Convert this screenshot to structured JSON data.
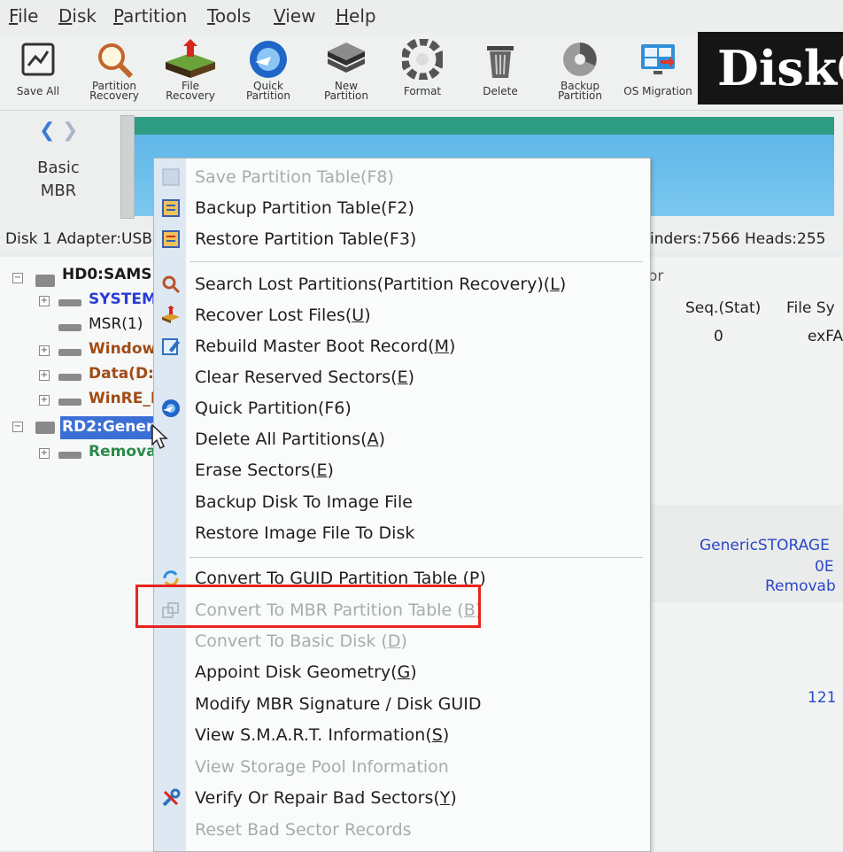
{
  "menubar": [
    {
      "pre": "",
      "u": "F",
      "post": "ile"
    },
    {
      "pre": "",
      "u": "D",
      "post": "isk"
    },
    {
      "pre": "",
      "u": "P",
      "post": "artition"
    },
    {
      "pre": "",
      "u": "T",
      "post": "ools"
    },
    {
      "pre": "",
      "u": "V",
      "post": "iew"
    },
    {
      "pre": "",
      "u": "H",
      "post": "elp"
    }
  ],
  "toolbar": [
    {
      "line1": "Save All",
      "line2": "",
      "icon": "save-all-icon"
    },
    {
      "line1": "Partition",
      "line2": "Recovery",
      "icon": "magnifier-icon"
    },
    {
      "line1": "File",
      "line2": "Recovery",
      "icon": "file-recovery-icon"
    },
    {
      "line1": "Quick",
      "line2": "Partition",
      "icon": "quick-partition-icon"
    },
    {
      "line1": "New",
      "line2": "Partition",
      "icon": "new-partition-icon"
    },
    {
      "line1": "Format",
      "line2": "",
      "icon": "format-icon"
    },
    {
      "line1": "Delete",
      "line2": "",
      "icon": "trash-icon"
    },
    {
      "line1": "Backup",
      "line2": "Partition",
      "icon": "backup-partition-icon"
    },
    {
      "line1": "OS Migration",
      "line2": "",
      "icon": "os-migration-icon"
    }
  ],
  "logo": "DiskG",
  "disk_mode": {
    "line1": "Basic",
    "line2": "MBR"
  },
  "disk_info": {
    "left": "Disk 1 Adapter:USB",
    "right": "inders:7566  Heads:255"
  },
  "tree": [
    {
      "label": "HD0:SAMS",
      "color": "#1a1a1a"
    },
    {
      "label": "SYSTEM",
      "color": "#2a3bd8"
    },
    {
      "label": "MSR(1)",
      "color": "#1a1a1a"
    },
    {
      "label": "Window",
      "color": "#a04b15"
    },
    {
      "label": "Data(D:",
      "color": "#a04b15"
    },
    {
      "label": "WinRE_I",
      "color": "#a04b15"
    },
    {
      "label": "RD2:Gener",
      "color": "#ffffff"
    },
    {
      "label": "Remova",
      "color": "#2a8a4a"
    }
  ],
  "right_pane": {
    "col_partial": "or",
    "seq_header": "Seq.(Stat)",
    "fs_header": "File Sy",
    "seq_value": "0",
    "fs_value": "exFA",
    "model": "GenericSTORAGE",
    "model_id": "0E",
    "type": "Removab",
    "number": "121"
  },
  "context_menu": [
    {
      "text": "Save Partition Table(F8)",
      "disabled": true,
      "icon": "save-table-icon"
    },
    {
      "text": "Backup Partition Table(F2)",
      "disabled": false,
      "icon": "backup-table-icon"
    },
    {
      "text": "Restore Partition Table(F3)",
      "disabled": false,
      "icon": "restore-table-icon"
    },
    {
      "text": "Search Lost Partitions(Partition Recovery)(",
      "u": "L",
      "post": ")",
      "disabled": false,
      "icon": "search-icon"
    },
    {
      "text": "Recover Lost Files(",
      "u": "U",
      "post": ")",
      "disabled": false,
      "icon": "recover-files-icon"
    },
    {
      "text": "Rebuild Master Boot Record(",
      "u": "M",
      "post": ")",
      "disabled": false,
      "icon": "rebuild-mbr-icon"
    },
    {
      "text": "Clear Reserved Sectors(",
      "u": "E",
      "post": ")",
      "disabled": false,
      "icon": ""
    },
    {
      "text": "Quick Partition(F6)",
      "disabled": false,
      "icon": "quick-partition-icon"
    },
    {
      "text": "Delete All Partitions(",
      "u": "A",
      "post": ")",
      "disabled": false,
      "icon": ""
    },
    {
      "text": "Erase Sectors(",
      "u": "E",
      "post": ")",
      "disabled": false,
      "icon": ""
    },
    {
      "text": "Backup Disk To Image File",
      "disabled": false,
      "icon": ""
    },
    {
      "text": "Restore Image File To Disk",
      "disabled": false,
      "icon": ""
    },
    {
      "text": "Convert To GUID Partition Table (",
      "u": "P",
      "post": ")",
      "disabled": false,
      "icon": "convert-gpt-icon"
    },
    {
      "text": "Convert To MBR Partition Table (",
      "u": "B",
      "post": ")",
      "disabled": true,
      "icon": "convert-mbr-icon"
    },
    {
      "text": "Convert To Basic Disk (",
      "u": "D",
      "post": ")",
      "disabled": true,
      "icon": ""
    },
    {
      "text": "Appoint Disk Geometry(",
      "u": "G",
      "post": ")",
      "disabled": false,
      "icon": ""
    },
    {
      "text": "Modify MBR Signature / Disk GUID",
      "disabled": false,
      "icon": ""
    },
    {
      "text": "View S.M.A.R.T. Information(",
      "u": "S",
      "post": ")",
      "disabled": false,
      "icon": ""
    },
    {
      "text": "View Storage Pool Information",
      "disabled": true,
      "icon": ""
    },
    {
      "text": "Verify Or Repair Bad Sectors(",
      "u": "Y",
      "post": ")",
      "disabled": false,
      "icon": "repair-tools-icon"
    },
    {
      "text": "Reset Bad Sector Records",
      "disabled": true,
      "icon": ""
    }
  ],
  "colors": {
    "accent_highlight": "#e8241e",
    "tree_selected": "#3c6fd6"
  }
}
